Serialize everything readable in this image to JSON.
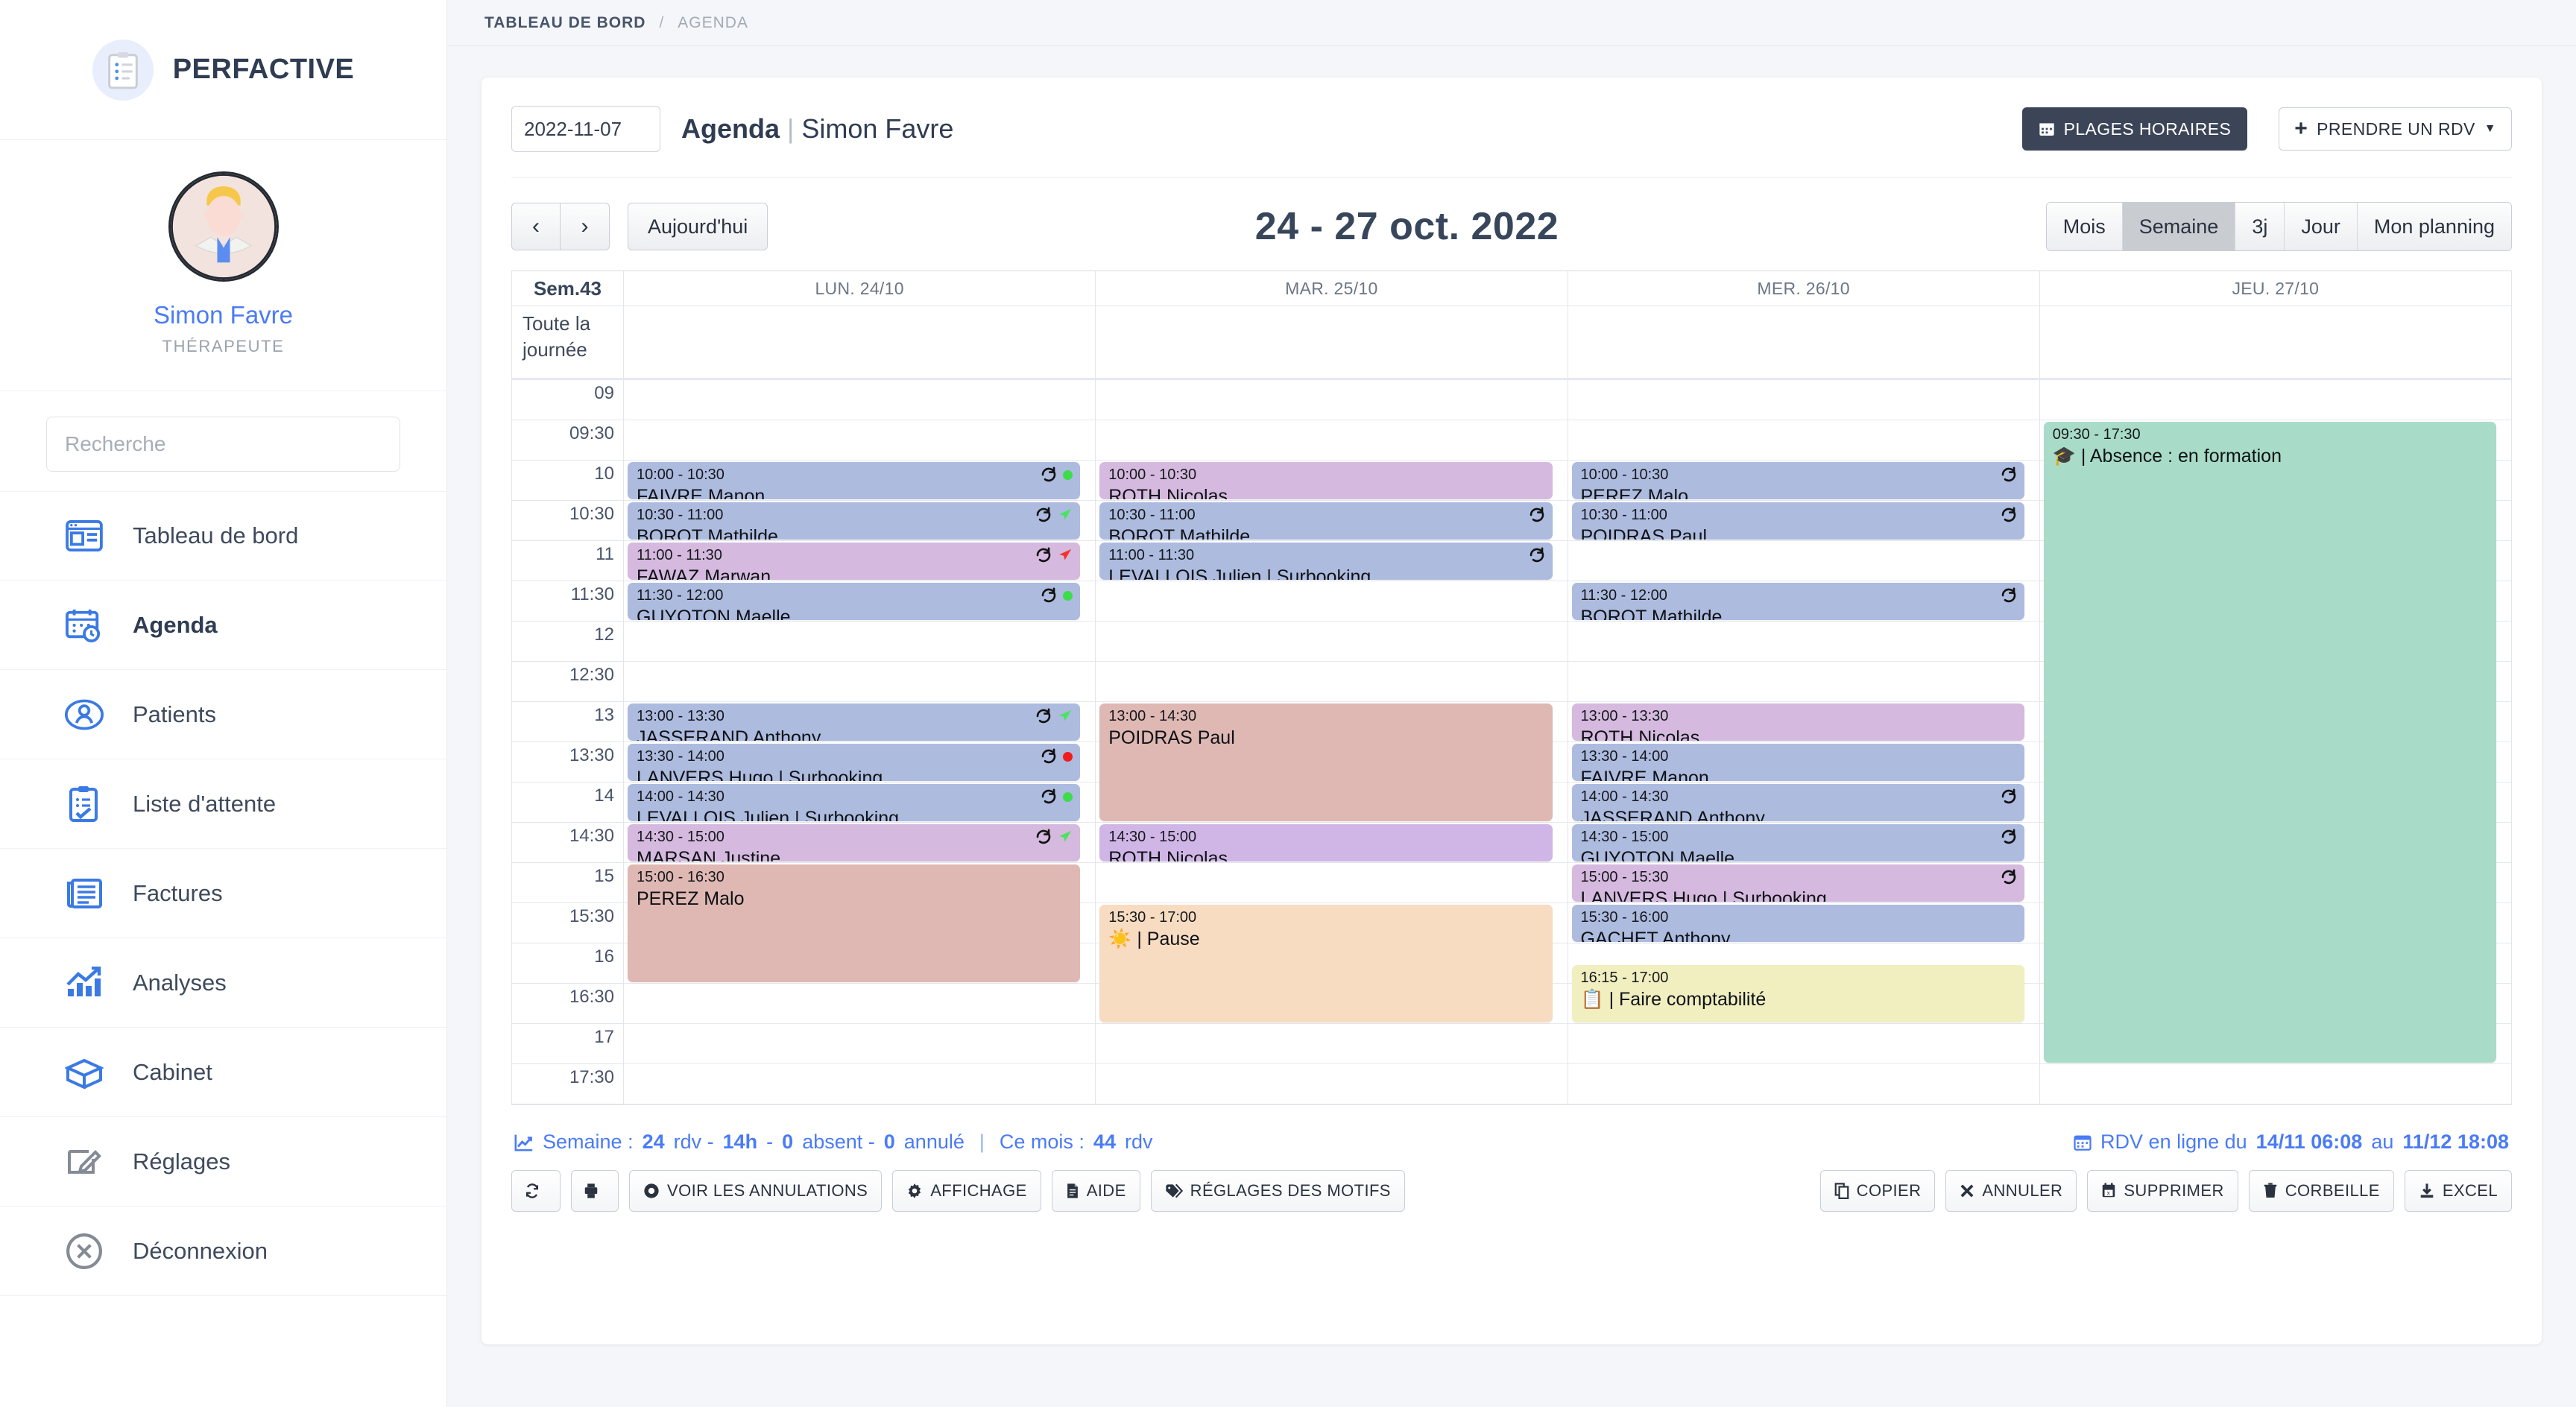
{
  "sidebar": {
    "brand": {
      "name": "PERFACTIVE",
      "icon": "clipboard-list-icon"
    },
    "profile": {
      "name": "Simon Favre",
      "role": "THÉRAPEUTE"
    },
    "search": {
      "placeholder": "Recherche",
      "value": ""
    },
    "items": [
      {
        "label": "Tableau de bord",
        "icon": "dashboard-icon",
        "active": false
      },
      {
        "label": "Agenda",
        "icon": "calendar-clock-icon",
        "active": true
      },
      {
        "label": "Patients",
        "icon": "patient-icon",
        "active": false
      },
      {
        "label": "Liste d'attente",
        "icon": "checklist-icon",
        "active": false
      },
      {
        "label": "Factures",
        "icon": "invoice-icon",
        "active": false
      },
      {
        "label": "Analyses",
        "icon": "bar-chart-icon",
        "active": false
      },
      {
        "label": "Cabinet",
        "icon": "box-icon",
        "active": false
      },
      {
        "label": "Réglages",
        "icon": "edit-square-icon",
        "active": false
      },
      {
        "label": "Déconnexion",
        "icon": "logout-circle-icon",
        "active": false
      }
    ]
  },
  "breadcrumb": {
    "root": "TABLEAU DE BORD",
    "sep": "/",
    "current": "AGENDA"
  },
  "header": {
    "date_value": "2022-11-07",
    "title_bold": "Agenda",
    "title_sep": "|",
    "title_rest": "Simon Favre",
    "plages_label": "PLAGES HORAIRES",
    "prendre_label": "PRENDRE UN RDV"
  },
  "toolbar": {
    "prev_label": "‹",
    "next_label": "›",
    "today_label": "Aujourd'hui",
    "range_title": "24 - 27 oct. 2022",
    "views": [
      {
        "label": "Mois",
        "active": false
      },
      {
        "label": "Semaine",
        "active": true
      },
      {
        "label": "3j",
        "active": false
      },
      {
        "label": "Jour",
        "active": false
      },
      {
        "label": "Mon planning",
        "active": false
      }
    ]
  },
  "calendar": {
    "week_label": "Sem.43",
    "allday_label": "Toute la journée",
    "days": [
      "LUN. 24/10",
      "MAR. 25/10",
      "MER. 26/10",
      "JEU. 27/10"
    ],
    "times": [
      "09",
      "09:30",
      "10",
      "10:30",
      "11",
      "11:30",
      "12",
      "12:30",
      "13",
      "13:30",
      "14",
      "14:30",
      "15",
      "15:30",
      "16",
      "16:30",
      "17",
      "17:30"
    ],
    "colors": {
      "blue": "#adbbdf",
      "purple": "#d5b9de",
      "purple_light": "#d0b6e6",
      "rose": "#dfb8b3",
      "peach": "#f7dcc2",
      "yellow": "#f1efc0",
      "mint": "#a8dcc8"
    },
    "events": [
      {
        "day": 0,
        "start": "10:00",
        "end": "10:30",
        "time": "10:00 - 10:30",
        "title": "FAIVRE Manon",
        "color": "blue",
        "icons": [
          "recur-icon",
          "green-dot"
        ]
      },
      {
        "day": 0,
        "start": "10:30",
        "end": "11:00",
        "time": "10:30 - 11:00",
        "title": "BOROT Mathilde",
        "color": "blue",
        "icons": [
          "recur-icon",
          "green-plane"
        ]
      },
      {
        "day": 0,
        "start": "11:00",
        "end": "11:30",
        "time": "11:00 - 11:30",
        "title": "FAWAZ Marwan",
        "color": "purple",
        "icons": [
          "recur-icon",
          "red-plane"
        ]
      },
      {
        "day": 0,
        "start": "11:30",
        "end": "12:00",
        "time": "11:30 - 12:00",
        "title": "GUYOTON Maelle",
        "color": "blue",
        "icons": [
          "recur-icon",
          "green-dot"
        ]
      },
      {
        "day": 0,
        "start": "13:00",
        "end": "13:30",
        "time": "13:00 - 13:30",
        "title": "JASSERAND Anthony",
        "color": "blue",
        "icons": [
          "recur-icon",
          "green-plane"
        ]
      },
      {
        "day": 0,
        "start": "13:30",
        "end": "14:00",
        "time": "13:30 - 14:00",
        "title": "LANVERS Hugo | Surbooking",
        "color": "blue",
        "icons": [
          "recur-icon",
          "red-dot"
        ]
      },
      {
        "day": 0,
        "start": "14:00",
        "end": "14:30",
        "time": "14:00 - 14:30",
        "title": "LEVALLOIS Julien | Surbooking",
        "color": "blue",
        "icons": [
          "recur-icon",
          "green-dot"
        ]
      },
      {
        "day": 0,
        "start": "14:30",
        "end": "15:00",
        "time": "14:30 - 15:00",
        "title": "MARSAN Justine",
        "color": "purple",
        "icons": [
          "recur-icon",
          "green-plane"
        ]
      },
      {
        "day": 0,
        "start": "15:00",
        "end": "16:30",
        "time": "15:00 - 16:30",
        "title": "PEREZ Malo",
        "color": "rose",
        "icons": []
      },
      {
        "day": 1,
        "start": "10:00",
        "end": "10:30",
        "time": "10:00 - 10:30",
        "title": "ROTH Nicolas",
        "color": "purple",
        "icons": []
      },
      {
        "day": 1,
        "start": "10:30",
        "end": "11:00",
        "time": "10:30 - 11:00",
        "title": "BOROT Mathilde",
        "color": "blue",
        "icons": [
          "recur-icon"
        ]
      },
      {
        "day": 1,
        "start": "11:00",
        "end": "11:30",
        "time": "11:00 - 11:30",
        "title": "LEVALLOIS Julien | Surbooking",
        "color": "blue",
        "icons": [
          "recur-icon"
        ]
      },
      {
        "day": 1,
        "start": "13:00",
        "end": "14:30",
        "time": "13:00 - 14:30",
        "title": "POIDRAS Paul",
        "color": "rose",
        "icons": []
      },
      {
        "day": 1,
        "start": "14:30",
        "end": "15:00",
        "time": "14:30 - 15:00",
        "title": "ROTH Nicolas",
        "color": "purple_light",
        "icons": []
      },
      {
        "day": 1,
        "start": "15:30",
        "end": "17:00",
        "time": "15:30 - 17:00",
        "title": "☀️ | Pause",
        "color": "peach",
        "icons": []
      },
      {
        "day": 2,
        "start": "10:00",
        "end": "10:30",
        "time": "10:00 - 10:30",
        "title": "PEREZ Malo",
        "color": "blue",
        "icons": [
          "recur-icon"
        ]
      },
      {
        "day": 2,
        "start": "10:30",
        "end": "11:00",
        "time": "10:30 - 11:00",
        "title": "POIDRAS Paul",
        "color": "blue",
        "icons": [
          "recur-icon"
        ]
      },
      {
        "day": 2,
        "start": "11:30",
        "end": "12:00",
        "time": "11:30 - 12:00",
        "title": "BOROT Mathilde",
        "color": "blue",
        "icons": [
          "recur-icon"
        ]
      },
      {
        "day": 2,
        "start": "13:00",
        "end": "13:30",
        "time": "13:00 - 13:30",
        "title": "ROTH Nicolas",
        "color": "purple",
        "icons": []
      },
      {
        "day": 2,
        "start": "13:30",
        "end": "14:00",
        "time": "13:30 - 14:00",
        "title": "FAIVRE Manon",
        "color": "blue",
        "icons": []
      },
      {
        "day": 2,
        "start": "14:00",
        "end": "14:30",
        "time": "14:00 - 14:30",
        "title": "JASSERAND Anthony",
        "color": "blue",
        "icons": [
          "recur-icon"
        ]
      },
      {
        "day": 2,
        "start": "14:30",
        "end": "15:00",
        "time": "14:30 - 15:00",
        "title": "GUYOTON Maelle",
        "color": "blue",
        "icons": [
          "recur-icon"
        ]
      },
      {
        "day": 2,
        "start": "15:00",
        "end": "15:30",
        "time": "15:00 - 15:30",
        "title": "LANVERS Hugo | Surbooking",
        "color": "purple",
        "icons": [
          "recur-icon"
        ]
      },
      {
        "day": 2,
        "start": "15:30",
        "end": "16:00",
        "time": "15:30 - 16:00",
        "title": "GACHET Anthony",
        "color": "blue",
        "icons": []
      },
      {
        "day": 2,
        "start": "16:15",
        "end": "17:00",
        "time": "16:15 - 17:00",
        "title": "📋 | Faire comptabilité",
        "color": "yellow",
        "icons": []
      },
      {
        "day": 3,
        "start": "09:30",
        "end": "17:30",
        "time": "09:30 - 17:30",
        "title": "🎓 | Absence : en formation",
        "color": "mint",
        "icons": []
      }
    ]
  },
  "footer": {
    "stats": {
      "icon": "chart-line-icon",
      "prefix": "Semaine : ",
      "rdv_count": "24",
      "rdv_word": " rdv - ",
      "hours": "14h",
      "dash1": " - ",
      "absent_count": "0",
      "absent_word": " absent - ",
      "cancel_count": "0",
      "cancel_word": " annulé ",
      "pipe": "|",
      "month_prefix": " Ce mois : ",
      "month_count": "44",
      "month_word": " rdv"
    },
    "online": {
      "icon": "calendar-icon",
      "prefix": "RDV en ligne du ",
      "from": "14/11 06:08",
      "mid": " au ",
      "to": "11/12 18:08"
    },
    "left_buttons": [
      {
        "label": "",
        "icon": "refresh-icon",
        "square": true
      },
      {
        "label": "",
        "icon": "printer-icon",
        "square": true
      },
      {
        "label": "VOIR LES ANNULATIONS",
        "icon": "eye-icon",
        "square": false
      },
      {
        "label": "AFFICHAGE",
        "icon": "gear-icon",
        "square": false
      },
      {
        "label": "AIDE",
        "icon": "doc-icon",
        "square": false
      },
      {
        "label": "RÉGLAGES DES MOTIFS",
        "icon": "tag-icon",
        "square": false
      }
    ],
    "right_buttons": [
      {
        "label": "COPIER",
        "icon": "copy-icon"
      },
      {
        "label": "ANNULER",
        "icon": "x-icon"
      },
      {
        "label": "SUPPRIMER",
        "icon": "calendar-x-icon"
      },
      {
        "label": "CORBEILLE",
        "icon": "trash-icon"
      },
      {
        "label": "EXCEL",
        "icon": "download-icon"
      }
    ]
  }
}
